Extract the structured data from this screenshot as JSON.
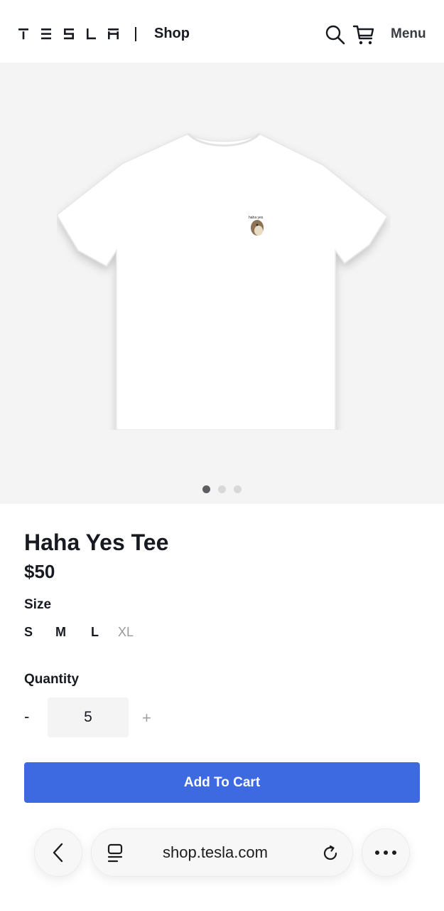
{
  "header": {
    "logo_text": "TESLA",
    "shop_label": "Shop",
    "menu_label": "Menu",
    "icons": [
      "search-icon",
      "cart-icon"
    ]
  },
  "gallery": {
    "image": "white-tee-with-hedgehog-print",
    "print_text": "haha yes",
    "dots": 3,
    "active_dot": 1
  },
  "product": {
    "title": "Haha Yes Tee",
    "price": "$50",
    "size_label": "Size",
    "sizes": [
      "S",
      "M",
      "L",
      "XL"
    ],
    "unavailable_sizes": [
      "XL"
    ],
    "quantity_label": "Quantity",
    "quantity_minus": "-",
    "quantity_value": "5",
    "quantity_plus": "+",
    "add_to_cart": "Add To Cart"
  },
  "browser": {
    "url": "shop.tesla.com",
    "icons": [
      "back-icon",
      "tabs-icon",
      "reload-icon",
      "more-icon"
    ]
  },
  "colors": {
    "accent": "#3e6ae1",
    "text": "#171a20",
    "gallery_bg": "#f4f4f4"
  }
}
